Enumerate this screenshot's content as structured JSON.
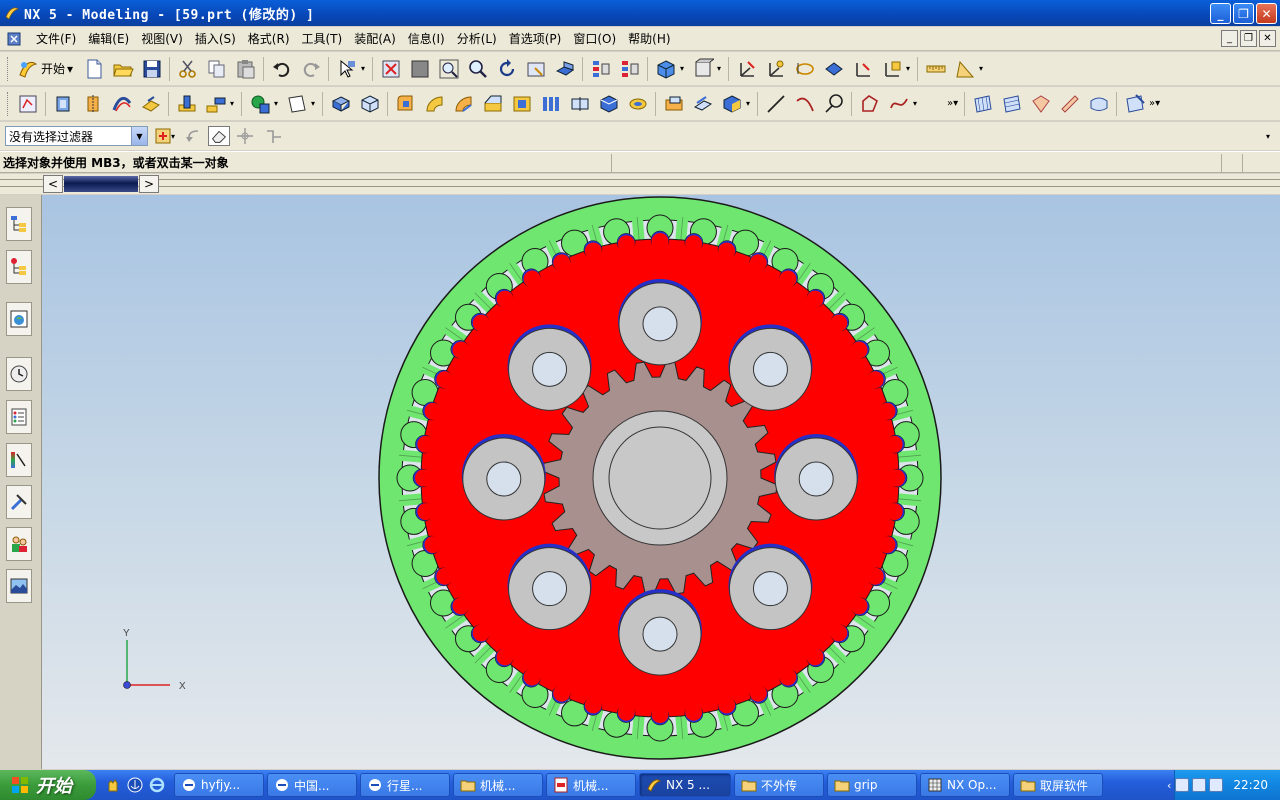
{
  "window": {
    "title": "NX 5 - Modeling - [59.prt  (修改的) ]"
  },
  "menu": {
    "items": [
      "文件(F)",
      "编辑(E)",
      "视图(V)",
      "插入(S)",
      "格式(R)",
      "工具(T)",
      "装配(A)",
      "信息(I)",
      "分析(L)",
      "首选项(P)",
      "窗口(O)",
      "帮助(H)"
    ]
  },
  "toolbar": {
    "start_label": "开始"
  },
  "filter": {
    "value": "没有选择过滤器"
  },
  "cue": {
    "text": "选择对象并使用 MB3，或者双击某一对象"
  },
  "triad": {
    "x_label": "X",
    "y_label": "Y"
  },
  "colors": {
    "ring": "#6fe66f",
    "carrier": "#ff0000",
    "planet": "#c4c4c4",
    "sun": "#a8908f",
    "blue_edge": "#2630c8"
  },
  "taskbar": {
    "start_label": "开始",
    "tasks": [
      "hyfjy...",
      "中国...",
      "行星...",
      "机械...",
      "机械...",
      "NX 5 ...",
      "不外传",
      "grip",
      "NX Op...",
      "取屏软件"
    ],
    "clock": "22:20"
  }
}
